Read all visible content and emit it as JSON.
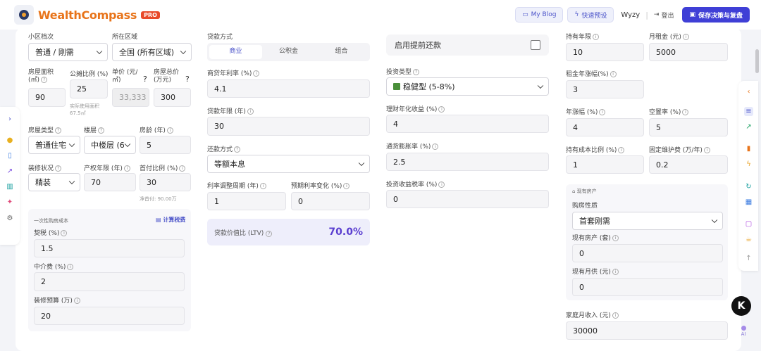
{
  "header": {
    "brand": "WealthCompass",
    "pro_badge": "PRO",
    "blog_label": "My Blog",
    "preset_label": "快速预设",
    "user_name": "Wyzy",
    "logout_label": "登出",
    "save_label": "保存决策与复盘"
  },
  "col1": {
    "community_level": {
      "label": "小区档次",
      "value": "普通 / 刚需"
    },
    "region": {
      "label": "所在区域",
      "value": "全国 (所有区域)"
    },
    "area": {
      "label": "房屋面积 (㎡)",
      "value": "90"
    },
    "share_ratio": {
      "label": "公摊比例 (%)",
      "value": "25",
      "note1": "实际使用面积",
      "note2": "67.5㎡"
    },
    "unit_price": {
      "label": "单价 (元/㎡)",
      "value": "33,333"
    },
    "total_price": {
      "label": "房屋总价 (万元)",
      "value": "300"
    },
    "house_type": {
      "label": "房屋类型",
      "value": "普通住宅"
    },
    "floor": {
      "label": "楼层",
      "value": "中楼层 (6"
    },
    "house_age": {
      "label": "房龄 (年)",
      "value": "5"
    },
    "decoration": {
      "label": "装修状况",
      "value": "精装"
    },
    "property_years": {
      "label": "产权年限 (年)",
      "value": "70"
    },
    "down_payment": {
      "label": "首付比例 (%)",
      "value": "30",
      "note": "净首付: 90.00万"
    },
    "one_time_cost": {
      "title": "一次性购房成本",
      "calc_label": "计算税费",
      "deed_tax": {
        "label": "契税 (%)",
        "value": "1.5"
      },
      "agent_fee": {
        "label": "中介费 (%)",
        "value": "2"
      },
      "renovation_budget": {
        "label": "装修预算 (万)",
        "value": "20"
      }
    }
  },
  "col2": {
    "loan_method": {
      "label": "贷款方式",
      "tabs": [
        "商业",
        "公积金",
        "组合"
      ],
      "active": 0
    },
    "commercial_rate": {
      "label": "商贷年利率 (%)",
      "value": "4.1"
    },
    "loan_years": {
      "label": "贷款年限 (年)",
      "value": "30"
    },
    "repay_method": {
      "label": "还款方式",
      "value": "等额本息"
    },
    "rate_adjust_cycle": {
      "label": "利率调整周期 (年)",
      "value": "1"
    },
    "expected_rate_change": {
      "label": "预期利率变化 (%)",
      "value": "0"
    },
    "ltv": {
      "label": "贷款价值比 (LTV)",
      "value": "70.0%"
    }
  },
  "col3": {
    "prepay": {
      "label": "启用提前还款"
    },
    "invest_type": {
      "label": "投资类型",
      "value": "稳健型 (5-8%)"
    },
    "financial_yield": {
      "label": "理财年化收益 (%)",
      "value": "4"
    },
    "inflation": {
      "label": "通货膨胀率 (%)",
      "value": "2.5"
    },
    "invest_tax": {
      "label": "投资收益税率 (%)",
      "value": "0"
    }
  },
  "col4": {
    "holding_years": {
      "label": "持有年限",
      "value": "10"
    },
    "monthly_rent": {
      "label": "月租金 (元)",
      "value": "5000"
    },
    "rent_growth": {
      "label": "租金年涨幅(%)",
      "value": "3"
    },
    "annual_appreciation": {
      "label": "年涨幅 (%)",
      "value": "4"
    },
    "vacancy": {
      "label": "空置率 (%)",
      "value": "5"
    },
    "holding_cost_ratio": {
      "label": "持有成本比例 (%)",
      "value": "1"
    },
    "maintenance": {
      "label": "固定维护费 (万/年)",
      "value": "0.2"
    },
    "existing": {
      "title": "现有房产",
      "nature": {
        "label": "购房性质",
        "value": "首套刚需"
      },
      "existing_count": {
        "label": "现有房产 (套)",
        "value": "0"
      },
      "existing_monthly": {
        "label": "现有月供 (元)",
        "value": "0"
      }
    },
    "family_income": {
      "label": "家庭月收入 (元)",
      "value": "30000"
    }
  },
  "float": {
    "k_label": "K",
    "ai_label": "AI"
  }
}
